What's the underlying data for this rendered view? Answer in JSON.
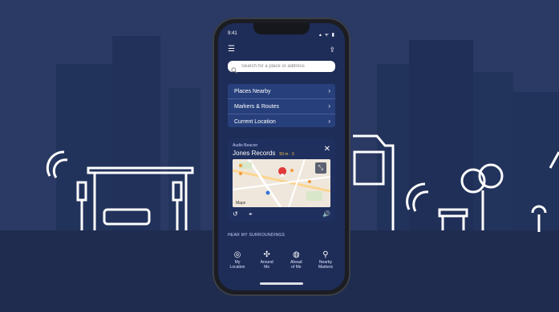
{
  "status": {
    "time": "9:41",
    "icons": "▴ ᯤ ▮"
  },
  "topbar": {
    "menu_icon": "☰",
    "share_icon": "⇪"
  },
  "search": {
    "placeholder": "Search for a place or address"
  },
  "nav": {
    "items": [
      {
        "label": "Places Nearby",
        "chev": "›"
      },
      {
        "label": "Markers & Routes",
        "chev": "›"
      },
      {
        "label": "Current Location",
        "chev": "›"
      }
    ]
  },
  "beacon": {
    "label": "Audio Beacon",
    "title": "Jones Records",
    "distance": "50 m · 3",
    "close": "✕",
    "map": {
      "logo": "Maps",
      "expand": "⤡"
    },
    "controls": {
      "rewind": "↺",
      "pin": "⌖",
      "volume": "🔊"
    }
  },
  "section": {
    "hear_label": "HEAR MY SURROUNDINGS"
  },
  "actions": [
    {
      "icon": "◎",
      "label1": "My",
      "label2": "Location"
    },
    {
      "icon": "✣",
      "label1": "Around",
      "label2": "Me"
    },
    {
      "icon": "◍",
      "label1": "Ahead",
      "label2": "of Me"
    },
    {
      "icon": "⚲",
      "label1": "Nearby",
      "label2": "Markers"
    }
  ],
  "colors": {
    "background": "#2b3b66",
    "screen": "#1e2c58",
    "accent": "#27407c",
    "pin": "#e03a3a"
  }
}
